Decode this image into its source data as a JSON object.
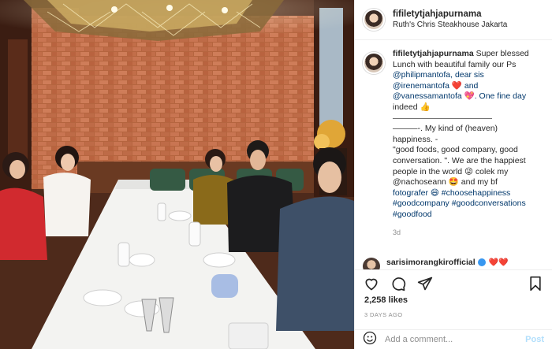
{
  "post": {
    "username": "fifiletytjahjapurnama",
    "location": "Ruth's Chris Steakhouse Jakarta"
  },
  "caption": {
    "username": "fifiletytjahjapurnama",
    "lines": [
      "Super blessed",
      "Lunch with beautiful family our Ps",
      "@philipmantofa, dear sis",
      "@irenemantofa ❤️ and",
      "@vanessamantofa 💖. One fine day",
      "indeed 👍",
      "————————————",
      "———-. My kind of (heaven)",
      "happiness. -",
      "\"good foods, good company, good",
      "conversation. \". We are the happiest",
      "people in the world 😜 colek my",
      "@nachoseann 🤩 and my bf",
      "fotografer 😄 #choosehappiness",
      "#goodcompany #goodconversations",
      "#goodfood"
    ],
    "age": "3d"
  },
  "comment_peek": {
    "username": "sarisimorangkirofficial",
    "emoji": "❤️❤️"
  },
  "stats": {
    "likes": "2,258 likes",
    "date": "3 DAYS AGO"
  },
  "comment_box": {
    "placeholder": "Add a comment...",
    "post_label": "Post"
  },
  "icons": {
    "like": "heart-icon",
    "comment": "comment-icon",
    "share": "share-icon",
    "save": "bookmark-icon",
    "emoji": "smiley-icon"
  },
  "colors": {
    "link": "#00376b",
    "muted": "#8e8e8e",
    "post_button": "#b2dffc"
  }
}
